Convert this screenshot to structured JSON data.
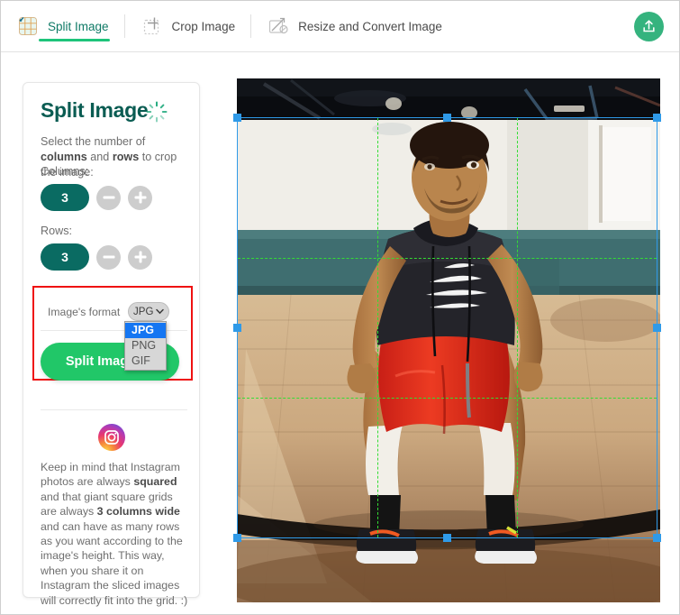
{
  "toolbar": {
    "tabs": [
      {
        "label": "Split Image",
        "icon": "grid-split-icon",
        "active": true
      },
      {
        "label": "Crop Image",
        "icon": "crop-icon",
        "active": false
      },
      {
        "label": "Resize and Convert Image",
        "icon": "resize-convert-icon",
        "active": false
      }
    ],
    "upload_button": {
      "icon": "upload-icon",
      "color": "#35b37e"
    }
  },
  "sidebar": {
    "title": "Split Image",
    "title_icon": "loading-burst-icon",
    "instructions_line1_a": "Select the number of ",
    "instructions_columns": "columns",
    "instructions_line2_a": " and ",
    "instructions_rows": "rows",
    "instructions_line2_b": " to crop the image:",
    "columns_label": "Columns:",
    "columns_value": "3",
    "rows_label": "Rows:",
    "rows_value": "3",
    "decrease_icon": "minus-icon",
    "increase_icon": "plus-icon",
    "format_label": "Image's format",
    "format_selected": "JPG",
    "format_options": [
      "JPG",
      "PNG",
      "GIF"
    ],
    "split_button_label": "Split Image",
    "split_button_icon": "scissors-icon",
    "split_button_color": "#21c768",
    "highlight_border_color": "#ef1111",
    "instagram_icon": "instagram-icon",
    "ig_t1": "Keep in mind that Instagram photos are always ",
    "ig_b1": "squared",
    "ig_t2": " and that giant square grids are always ",
    "ig_b2": "3 columns wide",
    "ig_t3": " and can have as many rows as you want according to the image's height. This way, when you share it on Instagram the sliced images will correctly fit into the grid. :)"
  },
  "image_panel": {
    "alt": "basketball-player-crouching-on-court",
    "selection": {
      "border_color": "#2f9ae8",
      "gridline_color": "#33dd33",
      "columns": 3,
      "rows": 3,
      "handles": [
        "top-left",
        "top-center",
        "top-right",
        "middle-left",
        "middle-right",
        "bottom-left",
        "bottom-center",
        "bottom-right"
      ]
    }
  }
}
